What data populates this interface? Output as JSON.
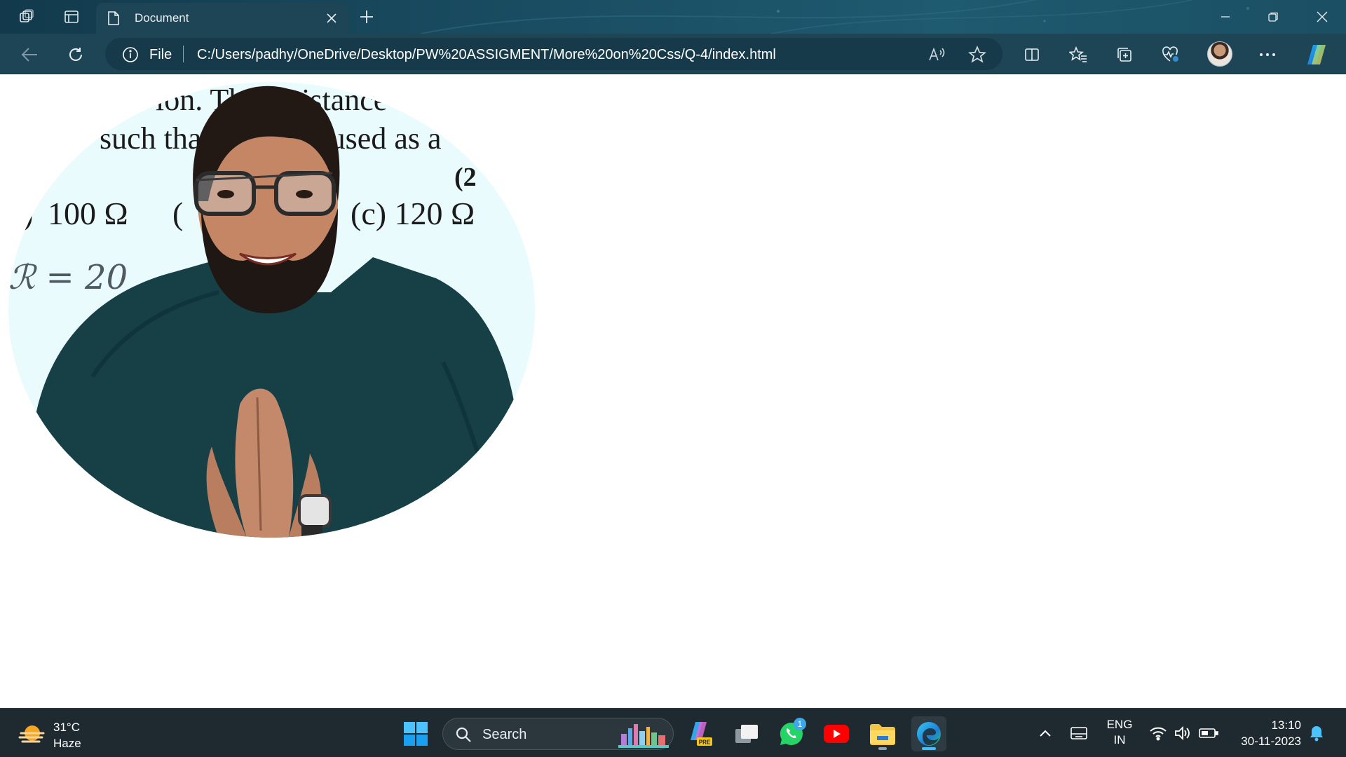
{
  "browser": {
    "tab_title": "Document",
    "address": {
      "scheme_label": "File",
      "url": "C:/Users/padhy/OneDrive/Desktop/PW%20ASSIGMENT/More%20on%20Css/Q-4/index.html"
    }
  },
  "page": {
    "photo": {
      "board_text": {
        "line1": "ion.  The resistance",
        "line2": "such that it can be used as a",
        "year_mark": "(2",
        "option_b": "100 Ω",
        "option_b_prefix": "(",
        "option_c": "(c)  120 Ω",
        "handwriting": "ℛ = 20"
      }
    }
  },
  "taskbar": {
    "weather": {
      "temp": "31°C",
      "condition": "Haze"
    },
    "search": {
      "label": "Search"
    },
    "whatsapp_badge": "1",
    "language": {
      "line1": "ENG",
      "line2": "IN"
    },
    "clock": {
      "time": "13:10",
      "date": "30-11-2023"
    }
  },
  "colors": {
    "titlebar": "#1a4d62",
    "toolbar": "#1e4556",
    "taskbar": "#1f2a30",
    "accent": "#3ec1ff"
  }
}
